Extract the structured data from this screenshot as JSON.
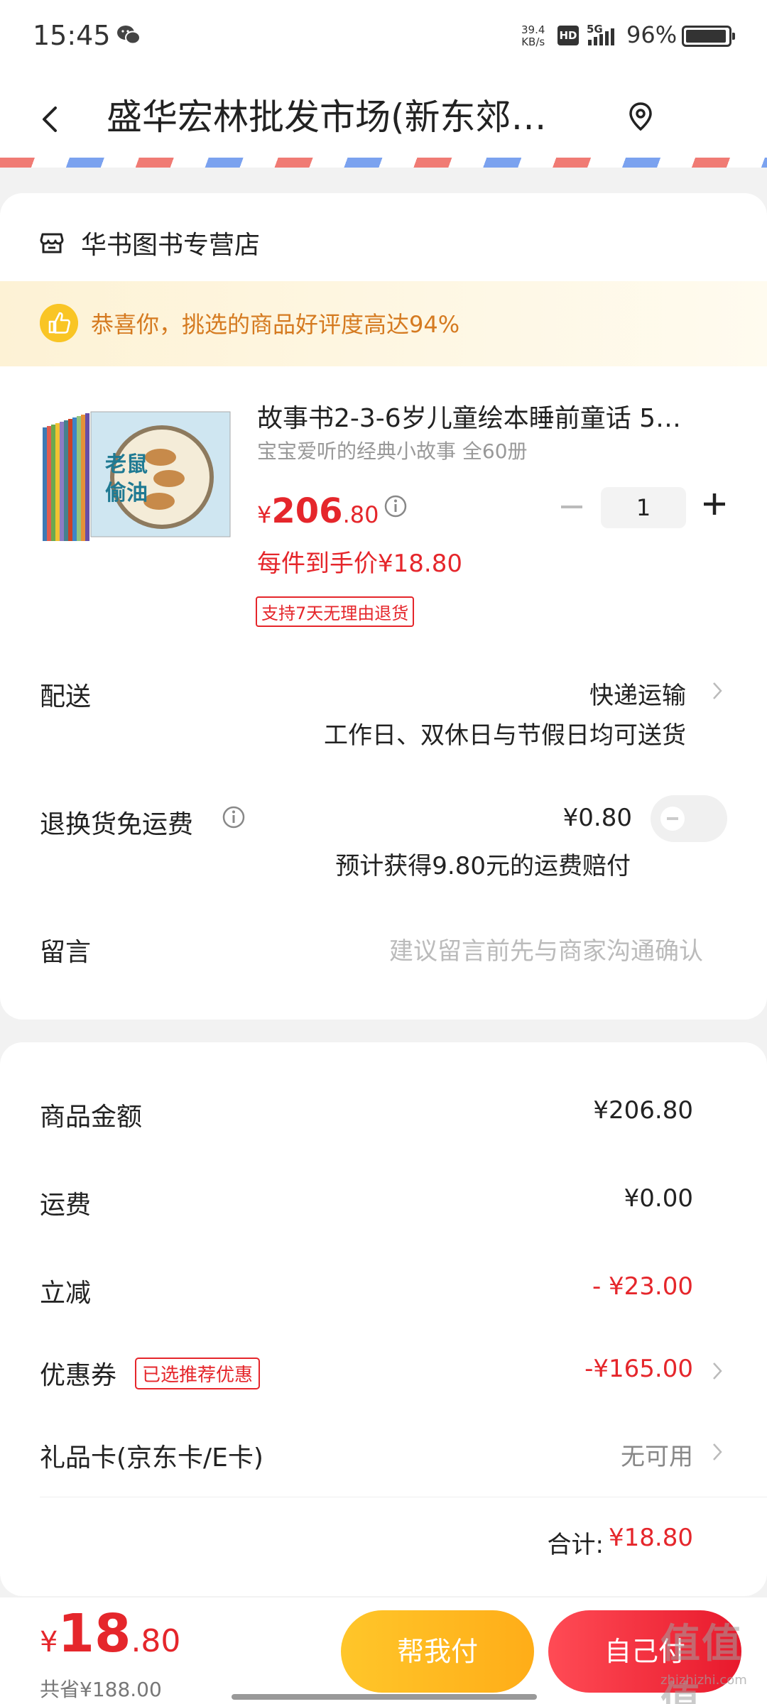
{
  "status_bar": {
    "time": "15:45",
    "net_speed_value": "39.4",
    "net_speed_unit": "KB/s",
    "hd": "HD",
    "signal": "5G",
    "battery": "96%",
    "battery_level": 0.96
  },
  "nav": {
    "title": "盛华宏林批发市场(新东郊…",
    "icons": [
      "back-icon",
      "location-pin-icon"
    ]
  },
  "shop": {
    "name": "华书图书专营店",
    "icon": "store-icon"
  },
  "praise": {
    "text": "恭喜你，挑选的商品好评度高达94%",
    "icon": "thumbs-up-icon"
  },
  "product": {
    "title": "故事书2-3-6岁儿童绘本睡前童话 5…",
    "subtitle": "宝宝爱听的经典小故事 全60册",
    "price_currency": "¥",
    "price_int": "206",
    "price_dec": ".80",
    "quantity": "1",
    "per_item_price": "每件到手价¥18.80",
    "refund_tag": "支持7天无理由退货",
    "cover_title": "老鼠偷油"
  },
  "delivery": {
    "label": "配送",
    "method": "快递运输",
    "note": "工作日、双休日与节假日均可送货"
  },
  "return_shipping": {
    "label": "退换货免运费",
    "price": "¥0.80",
    "note": "预计获得9.80元的运费赔付",
    "enabled": false
  },
  "message": {
    "label": "留言",
    "placeholder": "建议留言前先与商家沟通确认"
  },
  "summary": {
    "goods_label": "商品金额",
    "goods_value": "¥206.80",
    "shipping_label": "运费",
    "shipping_value": "¥0.00",
    "discount_label": "立减",
    "discount_value": "- ¥23.00",
    "coupon_label": "优惠券",
    "coupon_tag": "已选推荐优惠",
    "coupon_value": "-¥165.00",
    "giftcard_label": "礼品卡(京东卡/E卡)",
    "giftcard_value": "无可用",
    "total_label": "合计:",
    "total_value": "¥18.80"
  },
  "bottom": {
    "price_currency": "¥",
    "price_int": "18",
    "price_dec": ".80",
    "saved": "共省¥188.00",
    "help_pay": "帮我付",
    "self_pay": "自己付"
  },
  "watermark": {
    "text": "值值值",
    "site": "zhizhizhi.com"
  },
  "colors": {
    "accent_red": "#e5262b",
    "accent_yellow": "#ffb81f",
    "praise_text": "#d57a20"
  }
}
